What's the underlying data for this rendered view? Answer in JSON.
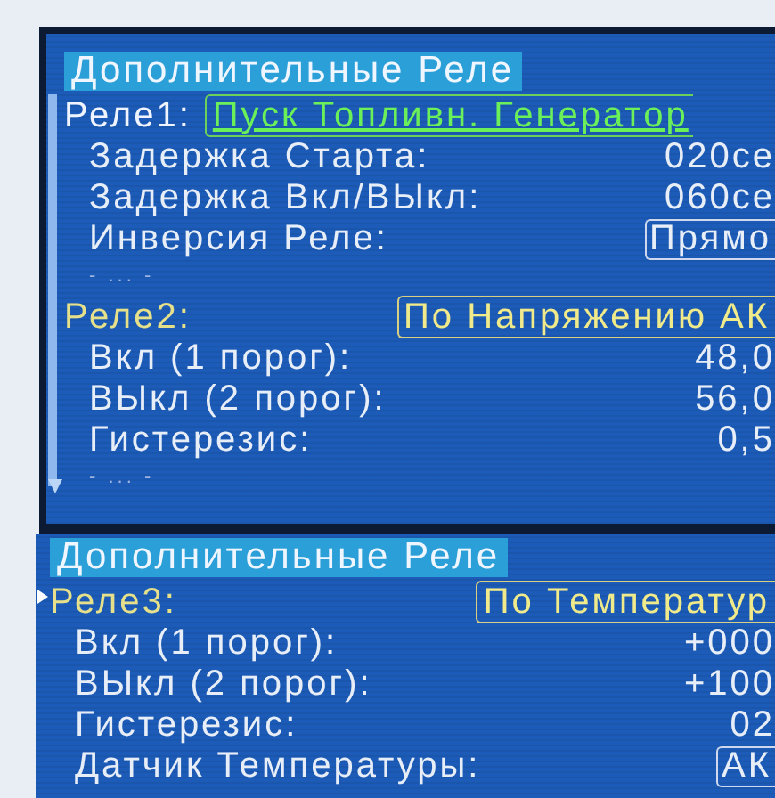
{
  "panels": [
    {
      "title": "Дополнительные Реле",
      "scrollbar": true,
      "relays": [
        {
          "label": "Реле1:",
          "mode": "Пуск Топливн. Генератор",
          "selected": true,
          "params": [
            {
              "label": "Задержка Старта:",
              "value": "020се",
              "kind": "text"
            },
            {
              "label": "Задержка Вкл/ВЫкл:",
              "value": "060се",
              "kind": "text"
            },
            {
              "label": "Инверсия Реле:",
              "value": "Прямо",
              "kind": "option"
            }
          ],
          "more": "- ... -"
        },
        {
          "label": "Реле2:",
          "mode": "По Напряжению АК",
          "selected": false,
          "params": [
            {
              "label": "Вкл (1 порог):",
              "value": "48,0",
              "kind": "text"
            },
            {
              "label": "ВЫкл (2 порог):",
              "value": "56,0",
              "kind": "text"
            },
            {
              "label": "Гистерезис:",
              "value": "0,5",
              "kind": "text"
            }
          ],
          "more": "- ... -"
        }
      ]
    },
    {
      "title": "Дополнительные Реле",
      "scrollbar": false,
      "relays": [
        {
          "label": "Реле3:",
          "mode": "По Температур",
          "selected": false,
          "params": [
            {
              "label": "Вкл (1 порог):",
              "value": "+000",
              "kind": "text"
            },
            {
              "label": "ВЫкл (2 порог):",
              "value": "+100",
              "kind": "text"
            },
            {
              "label": "Гистерезис:",
              "value": "02",
              "kind": "text"
            },
            {
              "label": "Датчик Температуры:",
              "value": "АК",
              "kind": "option"
            }
          ]
        }
      ]
    }
  ]
}
